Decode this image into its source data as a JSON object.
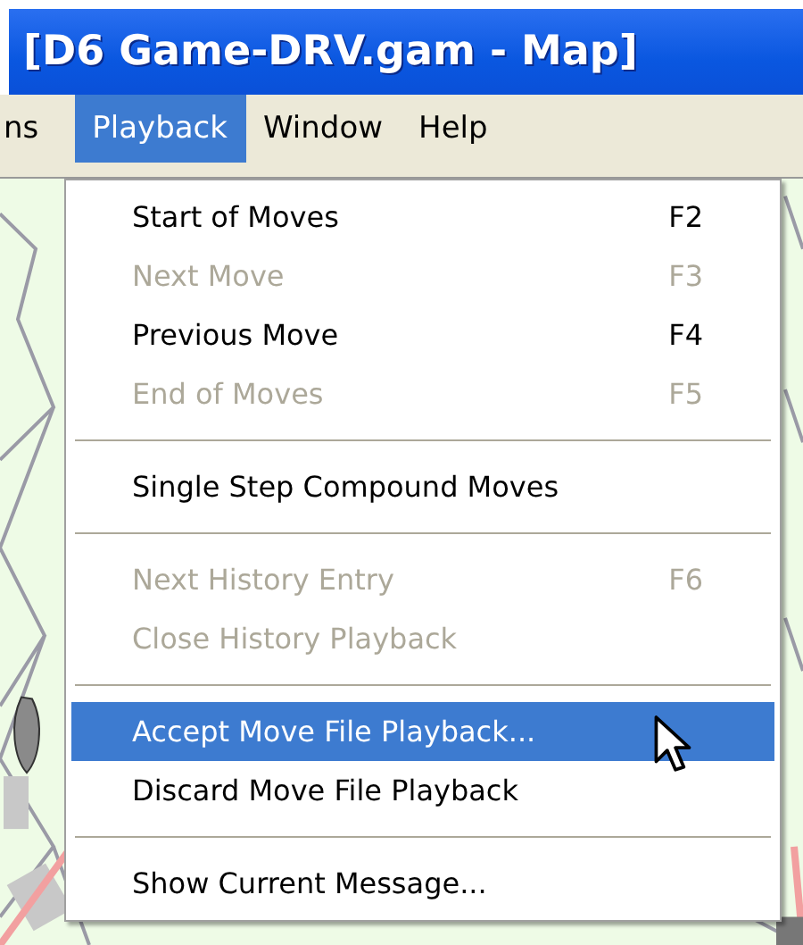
{
  "window": {
    "title": "[D6 Game-DRV.gam - Map]"
  },
  "menu_bar": [
    {
      "label": "ns",
      "selected": false
    },
    {
      "label": "Playback",
      "selected": true
    },
    {
      "label": "Window",
      "selected": false
    },
    {
      "label": "Help",
      "selected": false
    }
  ],
  "playback_menu": [
    {
      "kind": "item",
      "label": "Start of Moves",
      "shortcut": "F2",
      "disabled": false,
      "selected": false
    },
    {
      "kind": "item",
      "label": "Next Move",
      "shortcut": "F3",
      "disabled": true,
      "selected": false
    },
    {
      "kind": "item",
      "label": "Previous Move",
      "shortcut": "F4",
      "disabled": false,
      "selected": false
    },
    {
      "kind": "item",
      "label": "End of Moves",
      "shortcut": "F5",
      "disabled": true,
      "selected": false
    },
    {
      "kind": "separator"
    },
    {
      "kind": "item",
      "label": "Single Step Compound Moves",
      "disabled": false,
      "selected": false
    },
    {
      "kind": "separator"
    },
    {
      "kind": "item",
      "label": "Next History Entry",
      "shortcut": "F6",
      "disabled": true,
      "selected": false
    },
    {
      "kind": "item",
      "label": "Close History Playback",
      "disabled": true,
      "selected": false
    },
    {
      "kind": "separator"
    },
    {
      "kind": "item",
      "label": "Accept Move File Playback...",
      "disabled": false,
      "selected": true
    },
    {
      "kind": "item",
      "label": "Discard Move File Playback",
      "disabled": false,
      "selected": false
    },
    {
      "kind": "separator"
    },
    {
      "kind": "item",
      "label": "Show Current Message...",
      "disabled": false,
      "selected": false
    }
  ]
}
